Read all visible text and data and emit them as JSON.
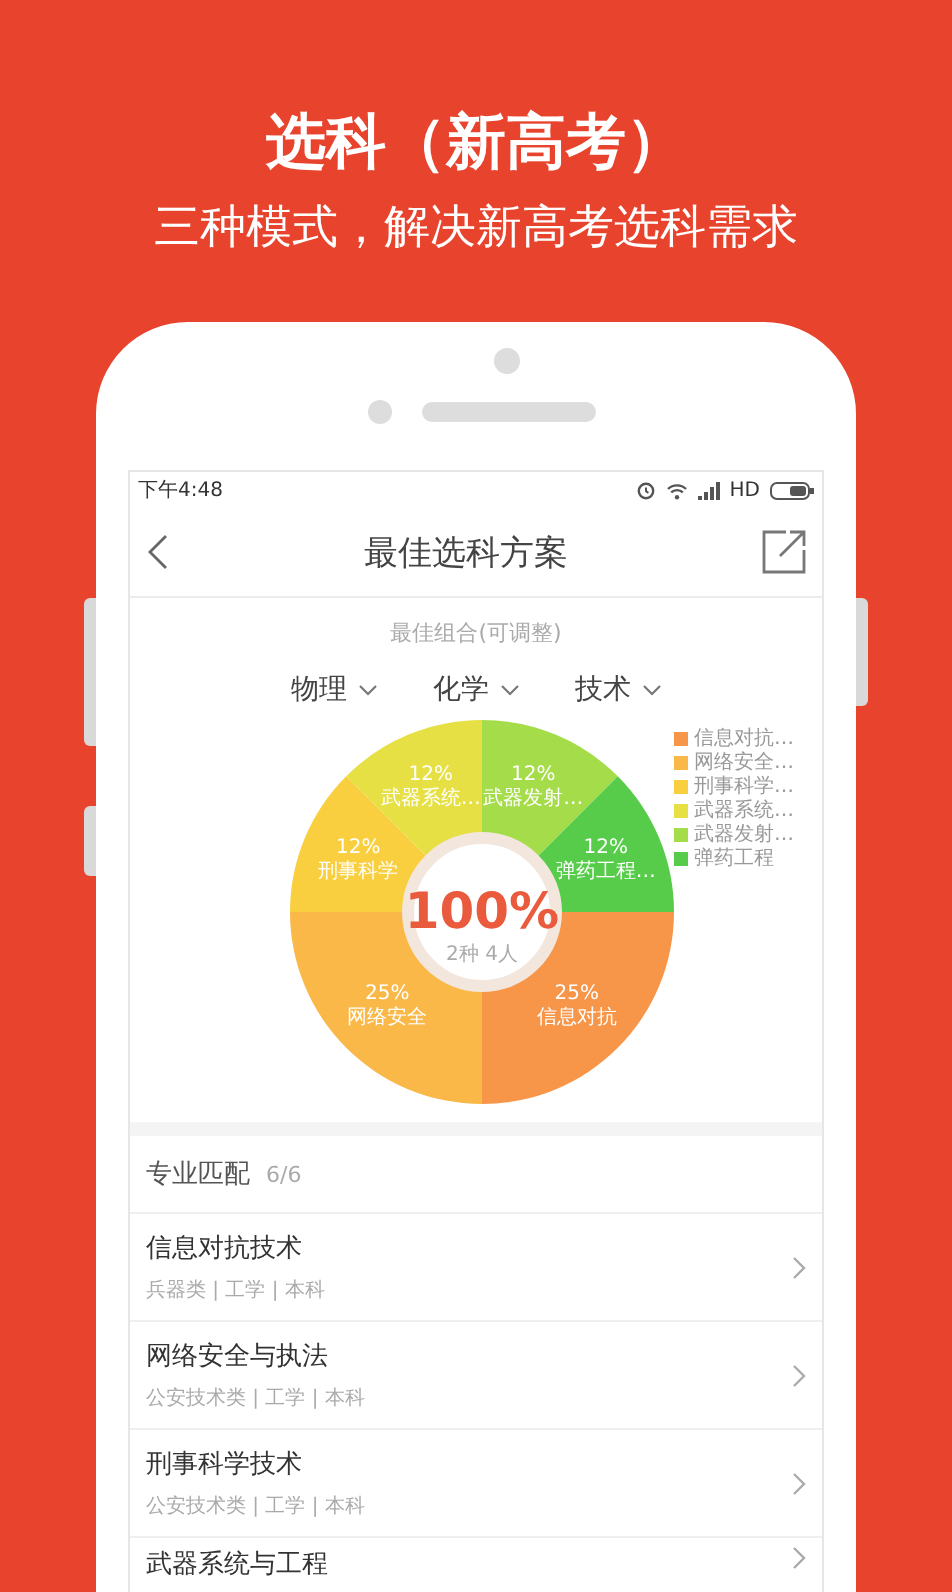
{
  "promo": {
    "title": "选科（新高考）",
    "subtitle": "三种模式，解决新高考选科需求"
  },
  "status_bar": {
    "time": "下午4:48",
    "network": "HD"
  },
  "nav": {
    "title": "最佳选科方案"
  },
  "combination": {
    "hint": "最佳组合(可调整)",
    "subjects": [
      "物理",
      "化学",
      "技术"
    ]
  },
  "chart": {
    "center_value": "100%",
    "center_caption": "2种 4人",
    "chart_data": {
      "type": "donut",
      "categories": [
        "信息对抗…",
        "网络安全…",
        "刑事科学…",
        "武器系统…",
        "武器发射…",
        "弹药工程"
      ],
      "values": [
        25,
        25,
        12.5,
        12.5,
        12.5,
        12.5
      ],
      "colors": [
        "#f79548",
        "#f9b847",
        "#f9cf3f",
        "#e6e045",
        "#a5dc4a",
        "#57cc4b"
      ]
    },
    "slice_labels": [
      {
        "value": "12%",
        "name": "武器系统…"
      },
      {
        "value": "12%",
        "name": "武器发射…"
      },
      {
        "value": "12%",
        "name": "刑事科学"
      },
      {
        "value": "12%",
        "name": "弹药工程…"
      },
      {
        "value": "25%",
        "name": "网络安全"
      },
      {
        "value": "25%",
        "name": "信息对抗"
      }
    ]
  },
  "majors": {
    "title": "专业匹配",
    "count": "6/6",
    "items": [
      {
        "name": "信息对抗技术",
        "meta": "兵器类 | 工学 | 本科"
      },
      {
        "name": "网络安全与执法",
        "meta": "公安技术类 | 工学 | 本科"
      },
      {
        "name": "刑事科学技术",
        "meta": "公安技术类 | 工学 | 本科"
      },
      {
        "name": "武器系统与工程"
      }
    ]
  }
}
